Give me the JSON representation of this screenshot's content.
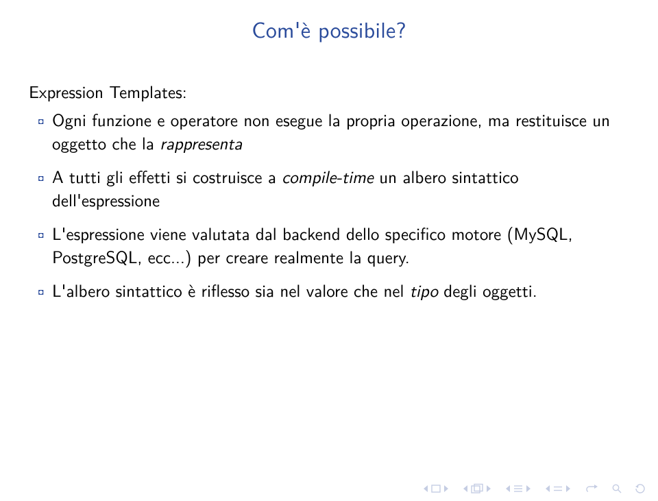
{
  "title": "Com'è possibile?",
  "body": {
    "heading": "Expression Templates:",
    "items": [
      {
        "pre": "Ogni funzione e operatore non esegue la propria operazione, ma restituisce un oggetto che la ",
        "em": "rappresenta",
        "post": ""
      },
      {
        "pre": "A tutti gli effetti si costruisce a ",
        "em": "compile-time",
        "post": " un albero sintattico dell'espressione"
      },
      {
        "pre": "L'espressione viene valutata dal backend dello specifico motore (MySQL, PostgreSQL, ecc...) per creare realmente la query.",
        "em": "",
        "post": ""
      },
      {
        "pre": "L'albero sintattico è riflesso sia nel valore che nel ",
        "em": "tipo",
        "post": " degli oggetti."
      }
    ]
  }
}
